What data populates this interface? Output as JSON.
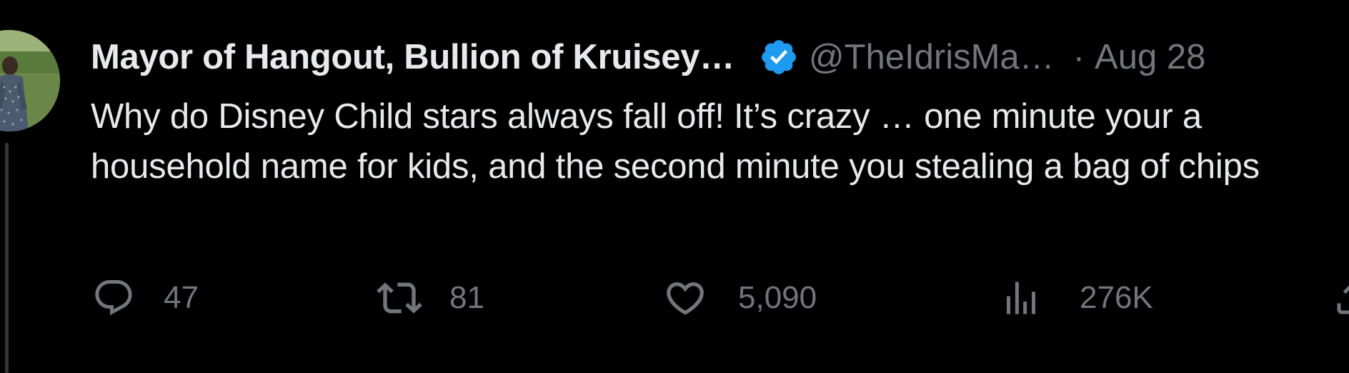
{
  "tweet": {
    "display_name": "Mayor of Hangout, Bullion of Kruisey…",
    "handle": "@TheIdrisMa…",
    "separator": "·",
    "date": "Aug 28",
    "text": "Why do Disney Child stars always fall off! It’s crazy … one minute your a household name for kids, and the second minute you stealing a bag of chips"
  },
  "actions": {
    "reply_count": "47",
    "retweet_count": "81",
    "like_count": "5,090",
    "views_count": "276K"
  },
  "icons": {
    "verified": "verified-badge-icon",
    "reply": "reply-icon",
    "retweet": "retweet-icon",
    "like": "heart-icon",
    "views": "views-chart-icon",
    "share": "share-icon"
  },
  "colors": {
    "background": "#000000",
    "text_primary": "#e7e9ea",
    "text_secondary": "#71767b",
    "verified_blue": "#1d9bf0"
  }
}
